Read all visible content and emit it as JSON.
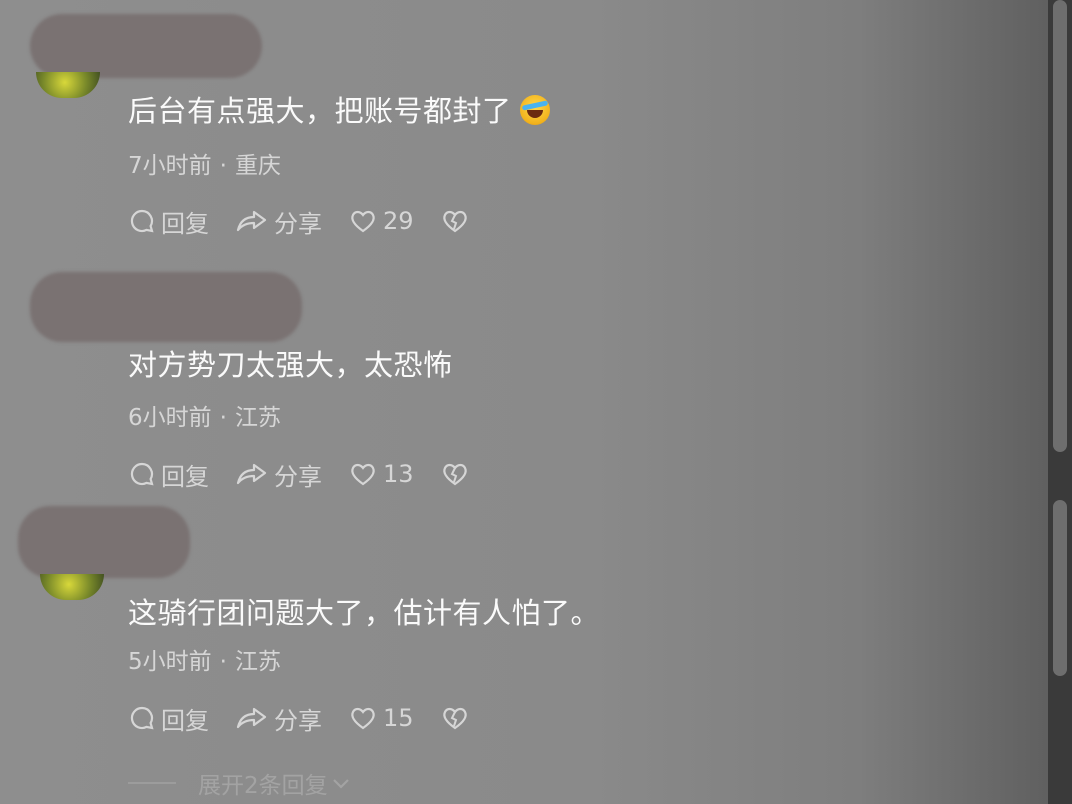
{
  "comments": [
    {
      "text": "后台有点强大，把账号都封了",
      "emoji": "rolling-on-floor-laughing-emoji",
      "time": "7小时前",
      "location": "重庆",
      "reply": "回复",
      "share": "分享",
      "likes": "29"
    },
    {
      "text": "对方势刀太强大，太恐怖",
      "time": "6小时前",
      "location": "江苏",
      "reply": "回复",
      "share": "分享",
      "likes": "13"
    },
    {
      "text": "这骑行团问题大了，估计有人怕了。",
      "time": "5小时前",
      "location": "江苏",
      "reply": "回复",
      "share": "分享",
      "likes": "15"
    }
  ],
  "expand_replies": "展开2条回复",
  "colors": {
    "background": "#8a8a8a",
    "text": "#fafafa",
    "muted": "#d6d6d6"
  }
}
